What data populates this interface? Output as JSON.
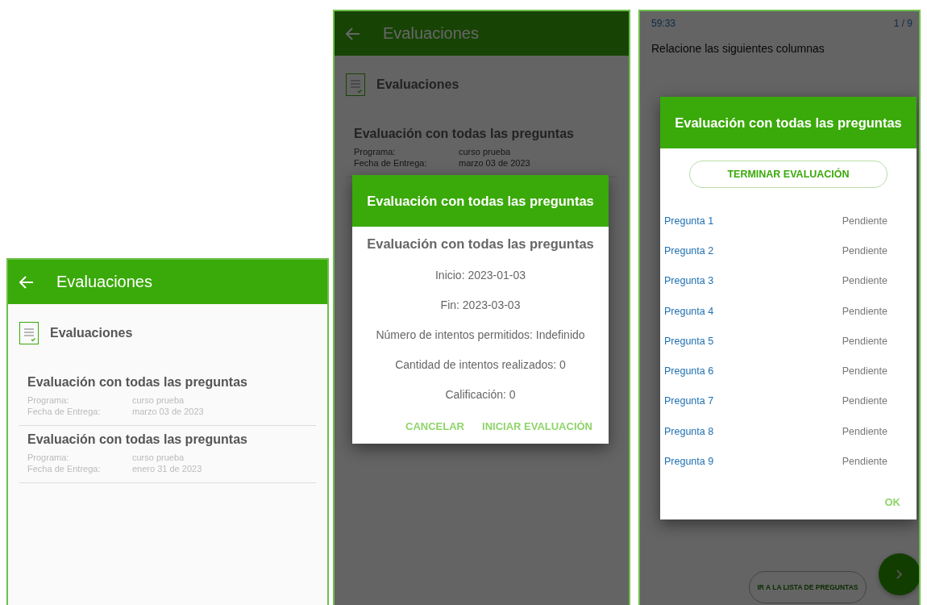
{
  "screens": [
    {
      "kind": "list",
      "app_bar": {
        "title": "Evaluaciones"
      },
      "section_title": "Evaluaciones",
      "items": [
        {
          "title": "Evaluación con todas las preguntas",
          "fields": [
            {
              "label": "Programa:",
              "value": "curso prueba"
            },
            {
              "label": "Fecha de Entrega:",
              "value": "marzo 03 de 2023"
            }
          ]
        },
        {
          "title": "Evaluación con todas las preguntas",
          "fields": [
            {
              "label": "Programa:",
              "value": "curso prueba"
            },
            {
              "label": "Fecha de Entrega:",
              "value": "enero 31 de 2023"
            }
          ]
        }
      ]
    },
    {
      "kind": "list",
      "app_bar": {
        "title": "Evaluaciones"
      },
      "section_title": "Evaluaciones",
      "items": [
        {
          "title": "Evaluación con todas las preguntas",
          "fields": [
            {
              "label": "Programa:",
              "value": "curso prueba"
            },
            {
              "label": "Fecha de Entrega:",
              "value": "marzo 03 de 2023"
            }
          ]
        }
      ],
      "dialog": {
        "kind": "details",
        "title": "Evaluación con todas las preguntas",
        "heading": "Evaluación con todas las preguntas",
        "lines": [
          "Inicio: 2023-01-03",
          "Fin: 2023-03-03",
          "Número de intentos permitidos: Indefinido",
          "Cantidad de intentos realizados: 0",
          "Calificación: 0"
        ],
        "actions": [
          "CANCELAR",
          "INICIAR EVALUACIÓN"
        ]
      }
    },
    {
      "kind": "quiz",
      "timer": "59:33",
      "progress": "1 / 9",
      "prompt": "Relacione las siguientes columnas",
      "list_button": "IR A LA LISTA DE PREGUNTAS",
      "dialog": {
        "kind": "questions",
        "title": "Evaluación con todas las preguntas",
        "finish_button": "TERMINAR EVALUACIÓN",
        "questions": [
          {
            "label": "Pregunta 1",
            "status": "Pendiente"
          },
          {
            "label": "Pregunta 2",
            "status": "Pendiente"
          },
          {
            "label": "Pregunta 3",
            "status": "Pendiente"
          },
          {
            "label": "Pregunta 4",
            "status": "Pendiente"
          },
          {
            "label": "Pregunta 5",
            "status": "Pendiente"
          },
          {
            "label": "Pregunta 6",
            "status": "Pendiente"
          },
          {
            "label": "Pregunta 7",
            "status": "Pendiente"
          },
          {
            "label": "Pregunta 8",
            "status": "Pendiente"
          },
          {
            "label": "Pregunta 9",
            "status": "Pendiente"
          }
        ],
        "actions": [
          "OK"
        ]
      }
    }
  ]
}
